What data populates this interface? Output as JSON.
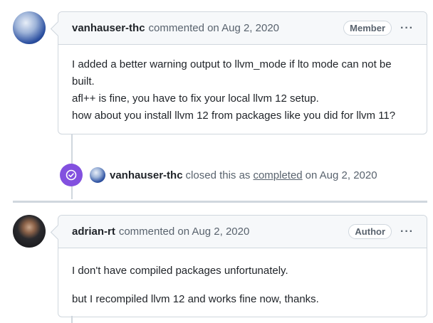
{
  "comment1": {
    "author": "vanhauser-thc",
    "meta": "commented on Aug 2, 2020",
    "badge": "Member",
    "menu": "···",
    "paragraphs": [
      "I added a better warning output to llvm_mode if lto mode can not be built.",
      "afl++ is fine, you have to fix your local llvm 12 setup.",
      "how about you install llvm 12 from packages like you did for llvm 11?"
    ]
  },
  "event": {
    "author": "vanhauser-thc",
    "text": "closed this as",
    "link": "completed",
    "date": "on Aug 2, 2020"
  },
  "comment2": {
    "author": "adrian-rt",
    "meta": "commented on Aug 2, 2020",
    "badge": "Author",
    "menu": "···",
    "paragraphs": [
      "I don't have compiled packages unfortunately.",
      "but I recompiled llvm 12 and works fine now, thanks."
    ]
  },
  "colors": {
    "event_icon": "#8250df",
    "border": "#d0d7de",
    "header_bg": "#f6f8fa"
  }
}
